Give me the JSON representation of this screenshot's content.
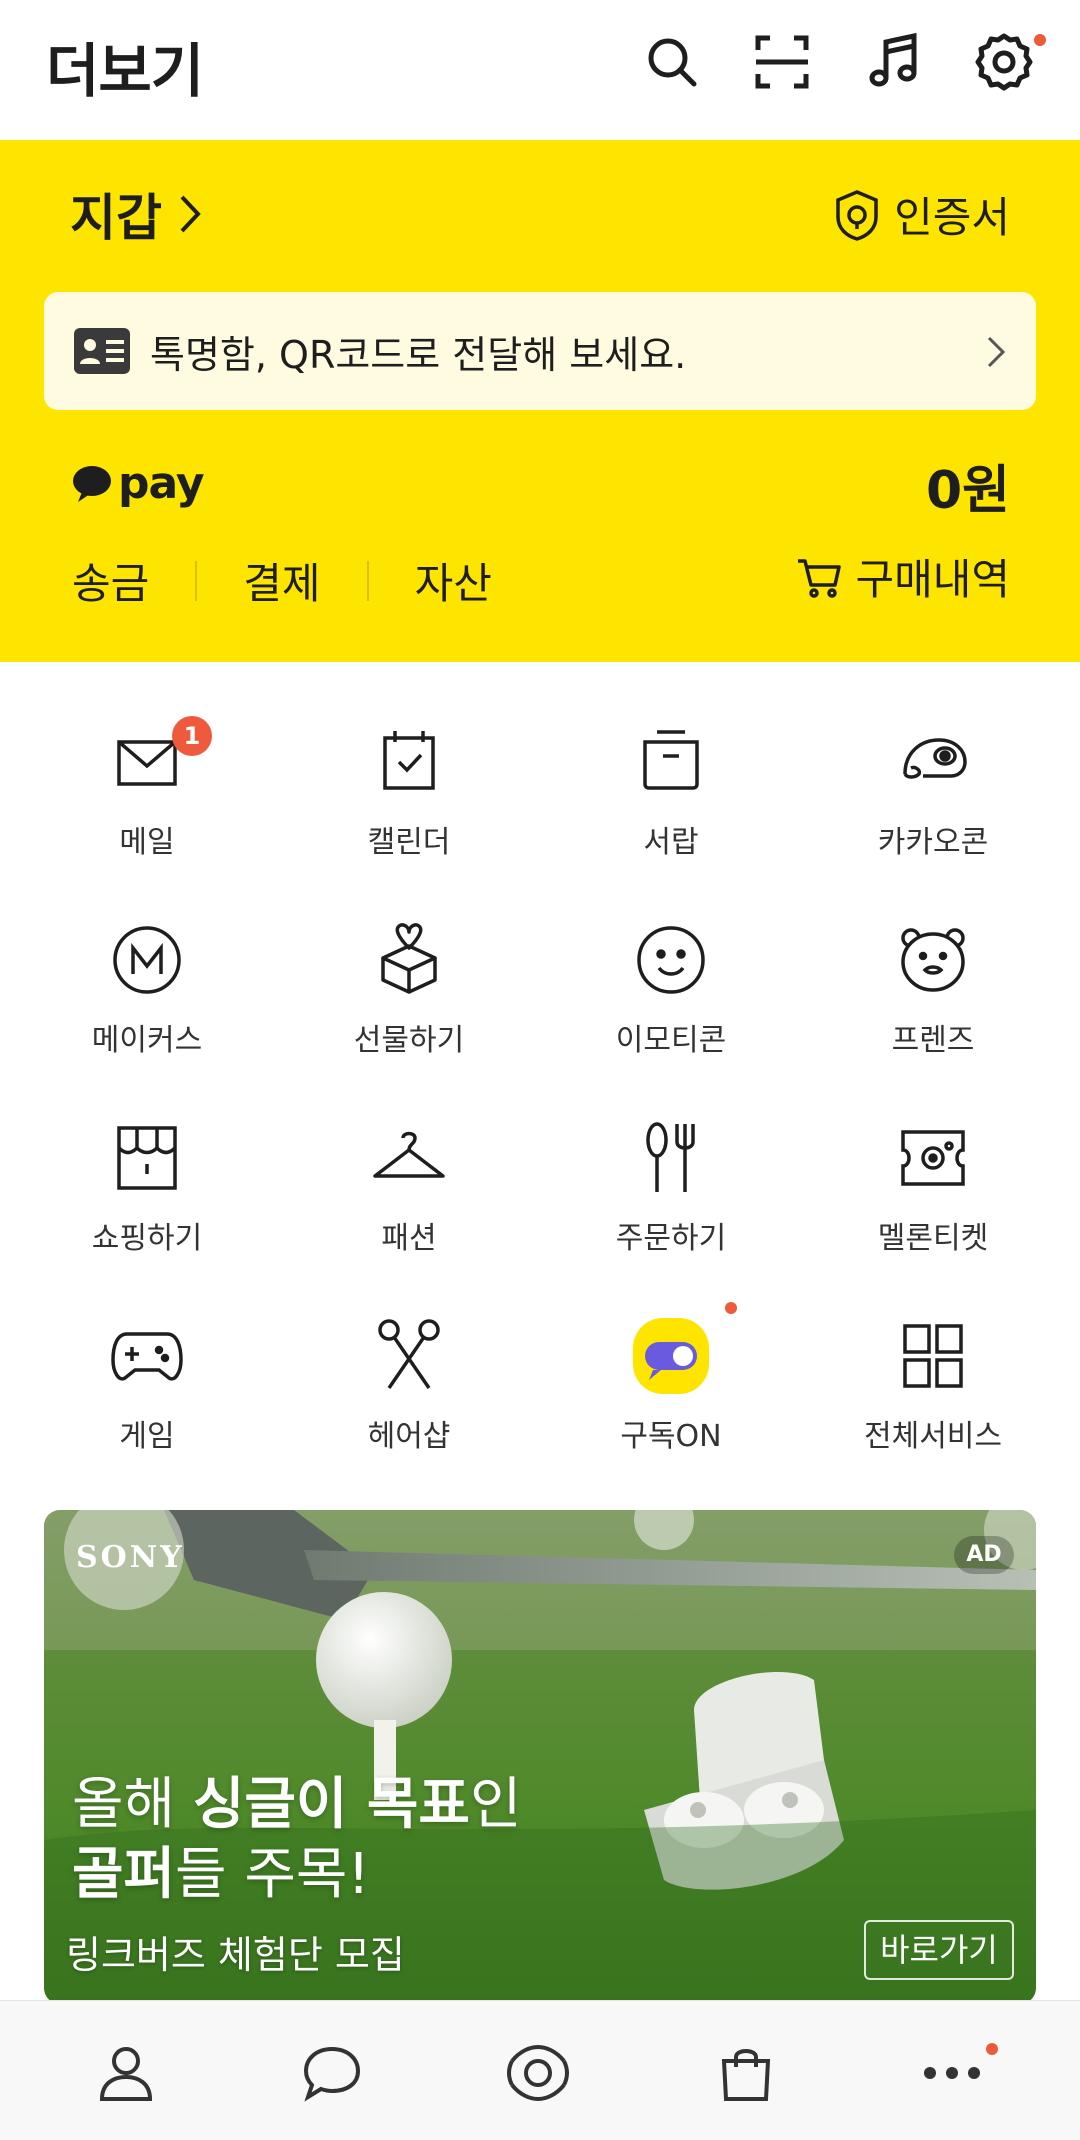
{
  "header": {
    "title": "더보기",
    "icons": [
      "search-icon",
      "qr-scan-icon",
      "music-icon",
      "gear-icon"
    ],
    "settings_has_new": true
  },
  "wallet": {
    "title": "지갑",
    "certificate_label": "인증서",
    "notice_text": "톡명함, QR코드로 전달해 보세요.",
    "pay_logo_text": "pay",
    "balance": "0원",
    "actions": [
      "송금",
      "결제",
      "자산"
    ],
    "purchase_history_label": "구매내역",
    "accent_color": "#fee500"
  },
  "services": [
    {
      "label": "메일",
      "icon": "mail-icon",
      "badge": "1"
    },
    {
      "label": "캘린더",
      "icon": "calendar-icon"
    },
    {
      "label": "서랍",
      "icon": "drawer-icon"
    },
    {
      "label": "카카오콘",
      "icon": "kakaocon-icon"
    },
    {
      "label": "메이커스",
      "icon": "makers-icon"
    },
    {
      "label": "선물하기",
      "icon": "gift-icon"
    },
    {
      "label": "이모티콘",
      "icon": "emoticon-icon"
    },
    {
      "label": "프렌즈",
      "icon": "friends-icon"
    },
    {
      "label": "쇼핑하기",
      "icon": "shopping-icon"
    },
    {
      "label": "패션",
      "icon": "hanger-icon"
    },
    {
      "label": "주문하기",
      "icon": "fork-spoon-icon"
    },
    {
      "label": "멜론티켓",
      "icon": "ticket-icon"
    },
    {
      "label": "게임",
      "icon": "gamepad-icon"
    },
    {
      "label": "헤어샵",
      "icon": "scissors-icon"
    },
    {
      "label": "구독ON",
      "icon": "subscription-toggle-icon",
      "has_new": true
    },
    {
      "label": "전체서비스",
      "icon": "grid-icon"
    }
  ],
  "ad": {
    "brand": "SONY",
    "tag": "AD",
    "headline_pre": "올해 ",
    "headline_bold1": "싱글이 목표",
    "headline_mid": "인",
    "headline_bold2": "골퍼",
    "headline_post": "들 주목!",
    "subtext": "링크버즈 체험단 모집",
    "cta": "바로가기"
  },
  "bottom_nav": {
    "items": [
      "friends-tab-icon",
      "chat-tab-icon",
      "view-tab-icon",
      "shopping-tab-icon",
      "more-tab-icon"
    ],
    "active": "more-tab-icon"
  }
}
